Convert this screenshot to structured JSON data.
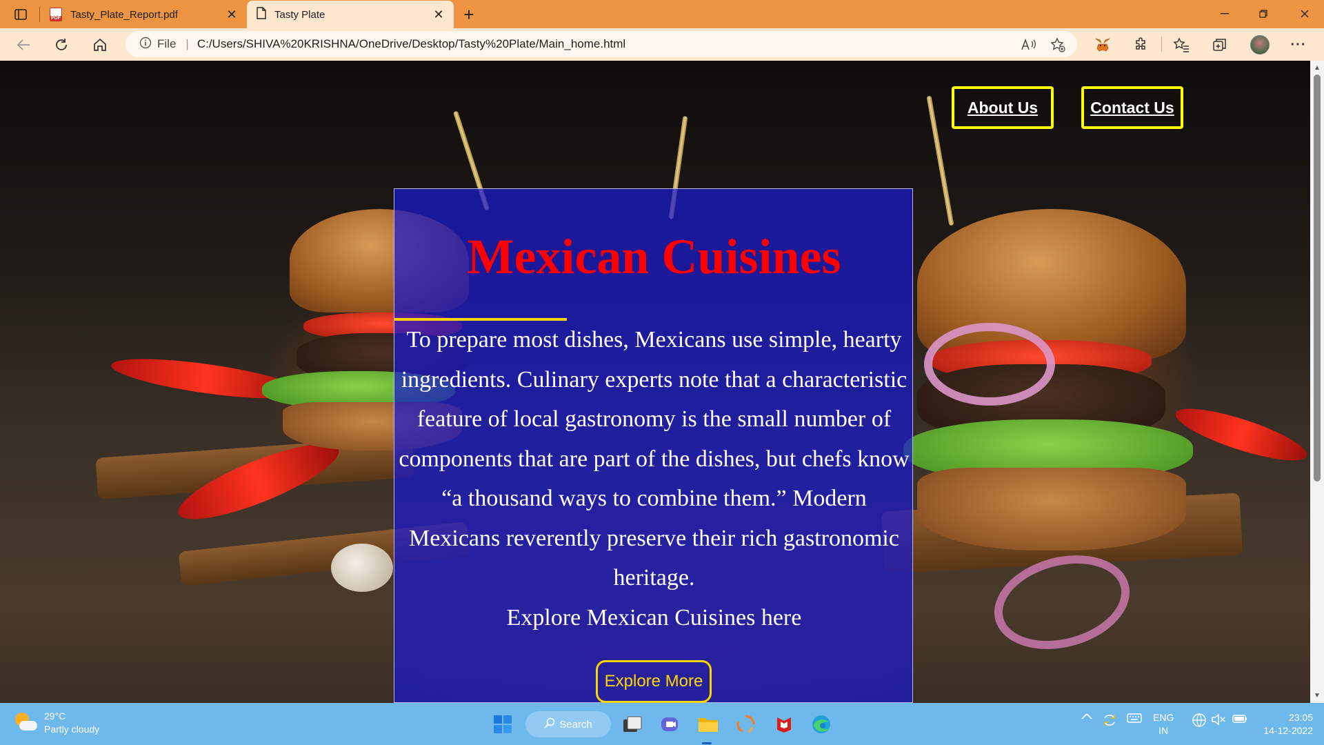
{
  "browser": {
    "tabs": [
      {
        "label": "Tasty_Plate_Report.pdf",
        "icon": "pdf-icon",
        "active": false
      },
      {
        "label": "Tasty Plate",
        "icon": "page-icon",
        "active": true
      }
    ],
    "address": {
      "scheme_label": "File",
      "url": "C:/Users/SHIVA%20KRISHNA/OneDrive/Desktop/Tasty%20Plate/Main_home.html"
    },
    "colors": {
      "frame": "#ec9441",
      "toolbar": "#fde7cf"
    }
  },
  "page": {
    "nav": {
      "about_label": "About Us",
      "contact_label": "Contact Us"
    },
    "panel": {
      "title": "Mexican Cuisines",
      "body": "To prepare most dishes, Mexicans use simple, hearty ingredients. Culinary experts note that a characteristic feature of local gastronomy is the small number of components that are part of the dishes, but chefs know “a thousand ways to combine them.” Modern Mexicans reverently preserve their rich gastronomic heritage.",
      "explore_line": "Explore Mexican Cuisines here",
      "button_label": "Explore More"
    },
    "colors": {
      "title": "#ff0000",
      "panel": "#1919cd",
      "nav_border": "#ffff00",
      "button": "#ffd700"
    }
  },
  "taskbar": {
    "weather": {
      "temp": "29°C",
      "condition": "Partly cloudy"
    },
    "search_label": "Search",
    "language": {
      "line1": "ENG",
      "line2": "IN"
    },
    "clock": {
      "time": "23:05",
      "date": "14-12-2022"
    }
  }
}
